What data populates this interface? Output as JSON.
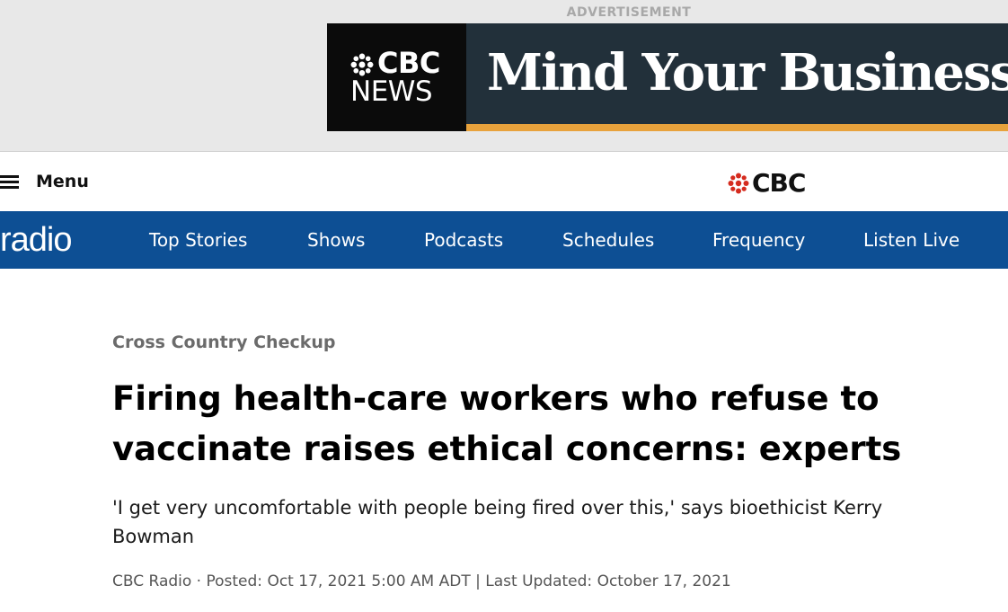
{
  "ad": {
    "label": "ADVERTISEMENT",
    "logo_top": "CBC",
    "logo_bottom": "NEWS",
    "headline": "Mind Your Business",
    "colors": {
      "banner": "#22303a",
      "stripe": "#e8a23c",
      "logo_bg": "#0b0b0b"
    }
  },
  "header": {
    "menu_icon": "hamburger-icon",
    "menu_label": "Menu",
    "logo_icon": "cbc-gem-icon",
    "logo_text": "CBC"
  },
  "nav": {
    "brand": "radio",
    "items": [
      {
        "label": "Top Stories"
      },
      {
        "label": "Shows"
      },
      {
        "label": "Podcasts"
      },
      {
        "label": "Schedules"
      },
      {
        "label": "Frequency"
      },
      {
        "label": "Listen Live"
      }
    ],
    "colors": {
      "background": "#0d4f94",
      "text": "#ffffff"
    }
  },
  "article": {
    "kicker": "Cross Country Checkup",
    "headline": "Firing health-care workers who refuse to vaccinate raises ethical concerns: experts",
    "dek": "'I get very uncomfortable with people being fired over this,' says bioethicist Kerry Bowman",
    "byline": "CBC Radio · Posted: Oct 17, 2021 5:00 AM ADT | Last Updated: October 17, 2021"
  }
}
